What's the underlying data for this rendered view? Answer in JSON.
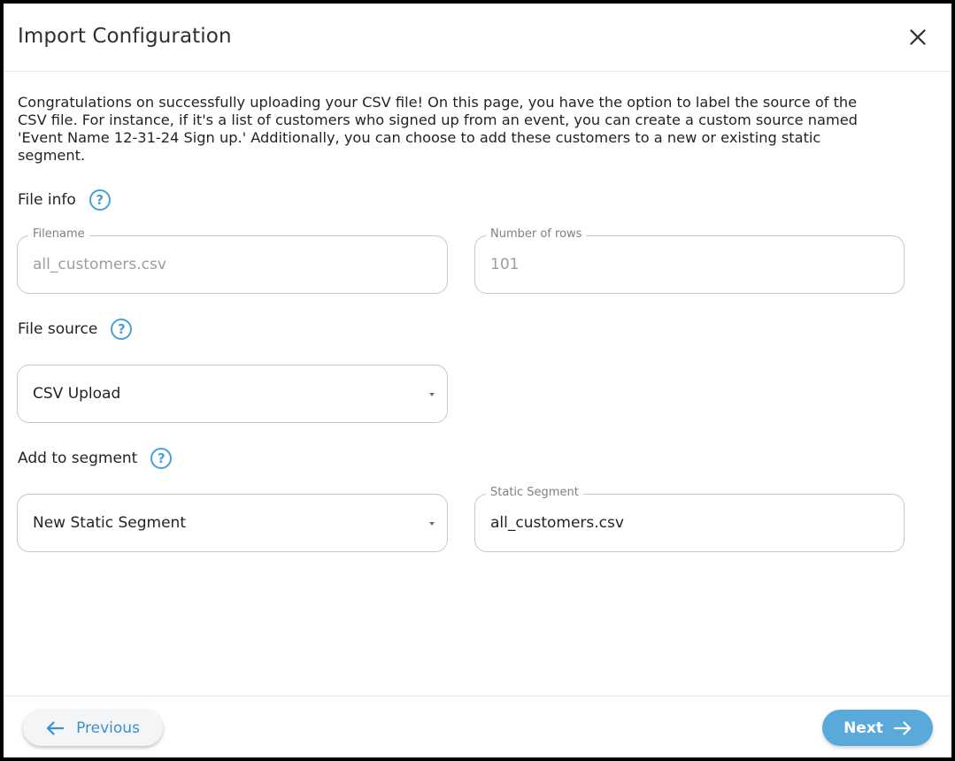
{
  "dialog": {
    "title": "Import Configuration",
    "close_icon": "close-icon"
  },
  "intro": {
    "text": "Congratulations on successfully uploading your CSV file! On this page, you have the option to label the source of the CSV file. For instance, if it's a list of customers who signed up from an event, you can create a custom source named 'Event Name 12-31-24 Sign up.' Additionally, you can choose to add these customers to a new or existing static segment."
  },
  "file_info": {
    "label": "File info",
    "help": "?",
    "filename": {
      "legend": "Filename",
      "value": "all_customers.csv"
    },
    "rows": {
      "legend": "Number of rows",
      "value": "101"
    }
  },
  "file_source": {
    "label": "File source",
    "help": "?",
    "selected": "CSV Upload"
  },
  "segment": {
    "label": "Add to segment",
    "help": "?",
    "selected": "New Static Segment",
    "static_segment": {
      "legend": "Static Segment",
      "value": "all_customers.csv"
    }
  },
  "footer": {
    "previous_label": "Previous",
    "next_label": "Next"
  },
  "colors": {
    "accent": "#5aa9db",
    "link": "#3a8fd0",
    "border": "#c4c7cc"
  }
}
